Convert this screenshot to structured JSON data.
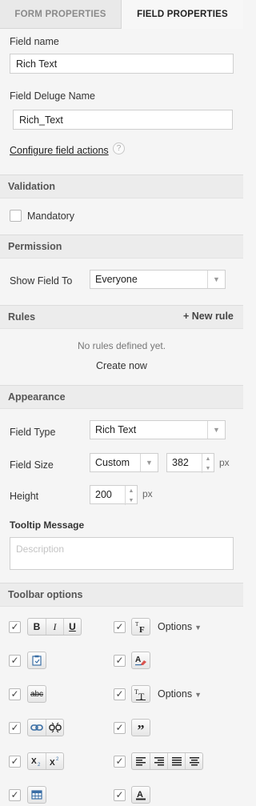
{
  "tabs": {
    "form": "FORM PROPERTIES",
    "field": "FIELD PROPERTIES"
  },
  "field_name": {
    "label": "Field name",
    "value": "Rich Text"
  },
  "deluge_name": {
    "label": "Field Deluge Name",
    "value": "Rich_Text"
  },
  "configure_link": "Configure field actions",
  "help_glyph": "?",
  "validation": {
    "title": "Validation",
    "mandatory": "Mandatory"
  },
  "permission": {
    "title": "Permission",
    "show_label": "Show Field To",
    "show_value": "Everyone"
  },
  "rules": {
    "title": "Rules",
    "new_rule": "+ New rule",
    "empty": "No rules defined yet.",
    "create": "Create now"
  },
  "appearance": {
    "title": "Appearance",
    "field_type_label": "Field Type",
    "field_type_value": "Rich Text",
    "field_size_label": "Field Size",
    "field_size_value": "Custom",
    "field_size_px": "382",
    "px": "px",
    "height_label": "Height",
    "height_value": "200",
    "tooltip_label": "Tooltip Message",
    "tooltip_placeholder": "Description"
  },
  "toolbar": {
    "title": "Toolbar options",
    "options": "Options",
    "bold": "B",
    "italic": "I",
    "underline": "U",
    "quote": "”"
  }
}
